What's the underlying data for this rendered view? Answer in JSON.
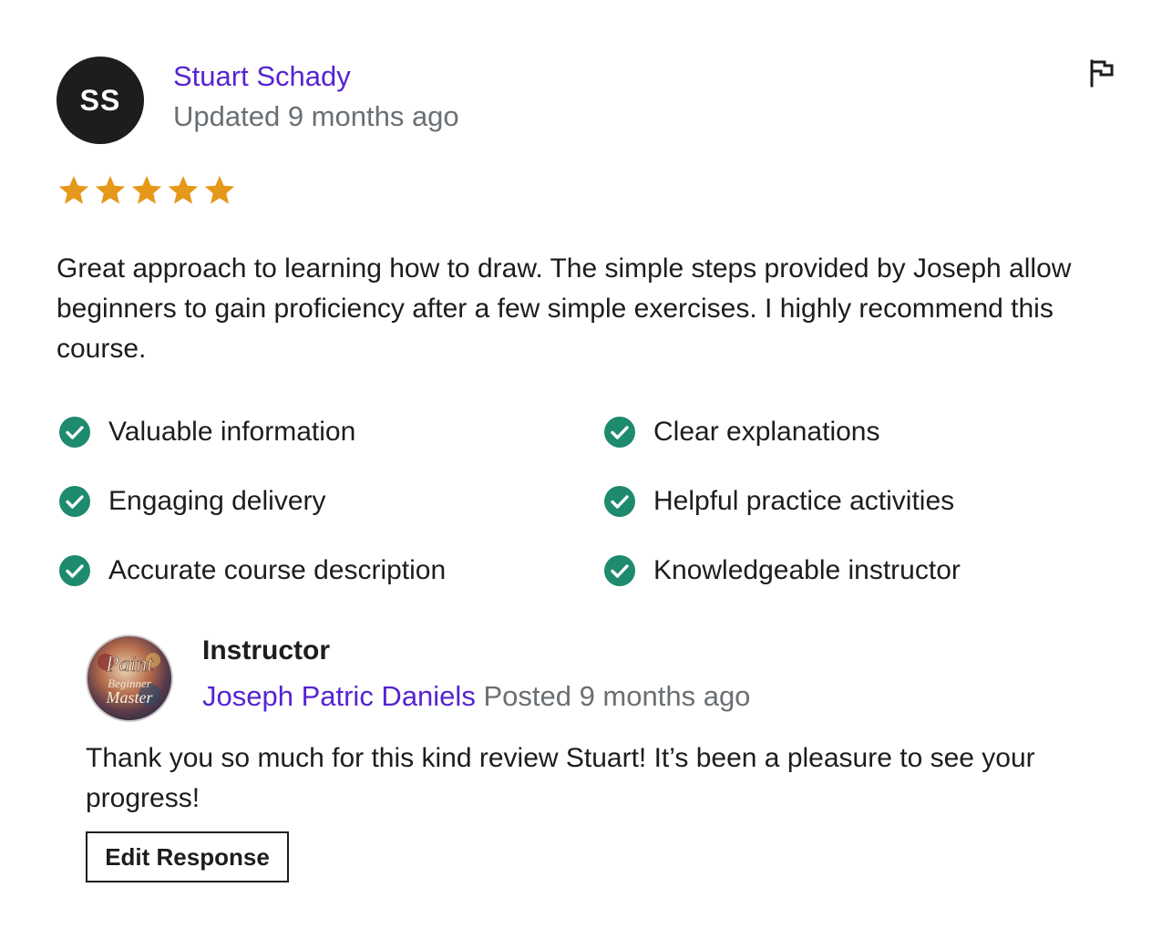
{
  "reviewer": {
    "initials": "SS",
    "name": "Stuart Schady",
    "updated": "Updated 9 months ago",
    "rating": 5,
    "rating_max": 5
  },
  "review": {
    "text": "Great approach to learning how to draw. The simple steps provided by Joseph allow beginners to gain proficiency after a few simple exercises. I highly recommend this course."
  },
  "features": [
    {
      "label": "Valuable information"
    },
    {
      "label": "Clear explanations"
    },
    {
      "label": "Engaging delivery"
    },
    {
      "label": "Helpful practice activities"
    },
    {
      "label": "Accurate course description"
    },
    {
      "label": "Knowledgeable instructor"
    }
  ],
  "response": {
    "role": "Instructor",
    "name": "Joseph Patric Daniels",
    "posted": "Posted 9 months ago",
    "text": "Thank you so much for this kind review Stuart! It’s been a pleasure to see your progress!",
    "edit_label": "Edit Response",
    "avatar_text": [
      "Paint",
      "Beginner",
      "Master"
    ]
  },
  "icons": {
    "flag": "flag-icon",
    "star": "star-icon",
    "check": "check-circle-icon"
  },
  "colors": {
    "link": "#5624d0",
    "muted": "#6a6f73",
    "star": "#e59819",
    "check": "#1e8a6e",
    "text": "#1c1d1f"
  }
}
